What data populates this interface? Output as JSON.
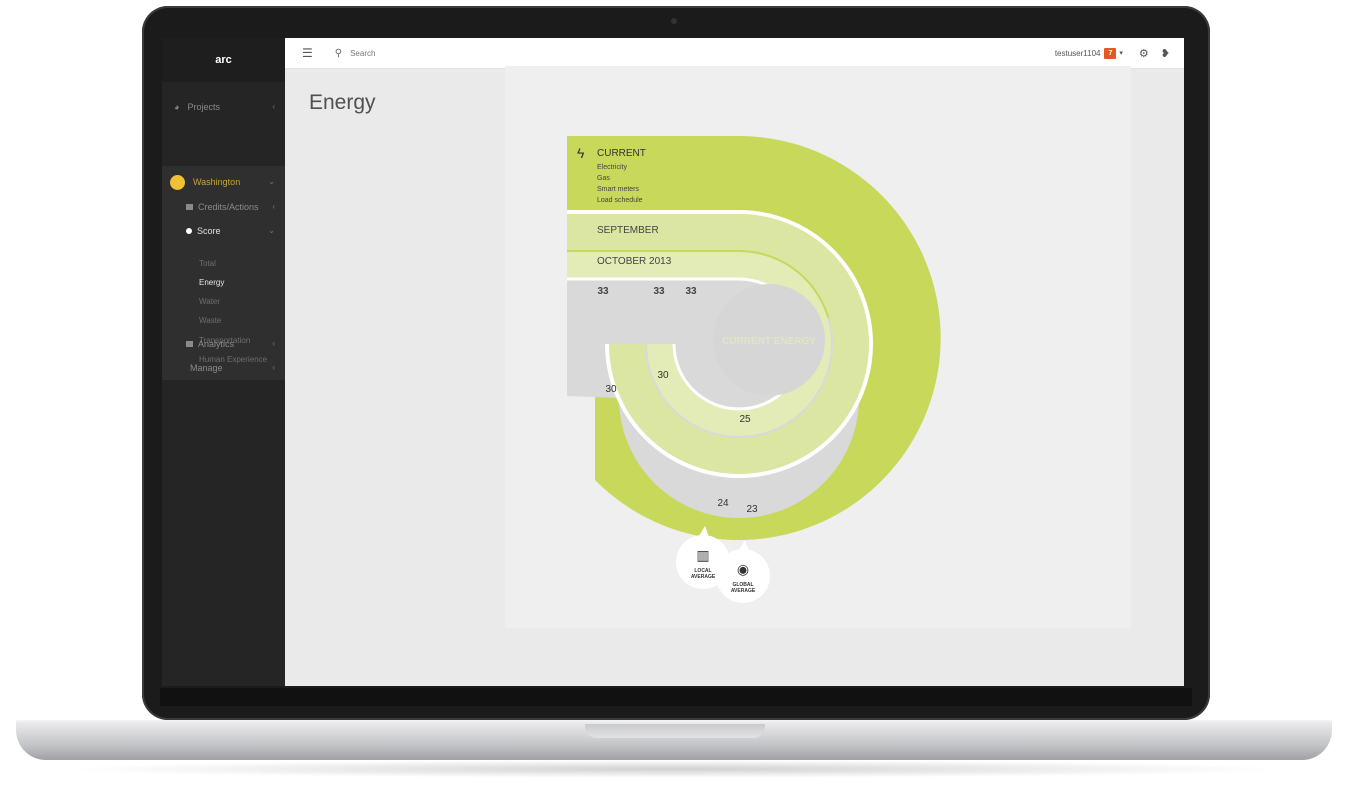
{
  "app": {
    "brand": "arc"
  },
  "sidebar": {
    "projects_label": "Projects",
    "project_name": "Washington",
    "credits_label": "Credits/Actions",
    "score_label": "Score",
    "score_items": [
      "Total",
      "Energy",
      "Water",
      "Waste",
      "Transportation",
      "Human Experience"
    ],
    "analytics_label": "Analytics",
    "manage_label": "Manage"
  },
  "topbar": {
    "search_placeholder": "Search",
    "username": "testuser1104",
    "notification_count": "7"
  },
  "page": {
    "title": "Energy"
  },
  "chart": {
    "current_heading": "CURRENT",
    "current_items": [
      "Electricity",
      "Gas",
      "Smart meters",
      "Load schedule"
    ],
    "band_labels": [
      "SEPTEMBER",
      "OCTOBER 2013"
    ],
    "center_label": "CURRENT ENERGY",
    "top_values": [
      "33",
      "33",
      "33"
    ],
    "arc_values": [
      "30",
      "30",
      "25",
      "24",
      "23"
    ],
    "markers": [
      {
        "icon": "buildings-icon",
        "label_line1": "LOCAL",
        "label_line2": "AVERAGE"
      },
      {
        "icon": "globe-icon",
        "label_line1": "GLOBAL",
        "label_line2": "AVERAGE"
      }
    ],
    "colors": {
      "primary": "#c8d85a",
      "secondary": "#dbe6a3",
      "track": "#d9d9d9"
    }
  }
}
